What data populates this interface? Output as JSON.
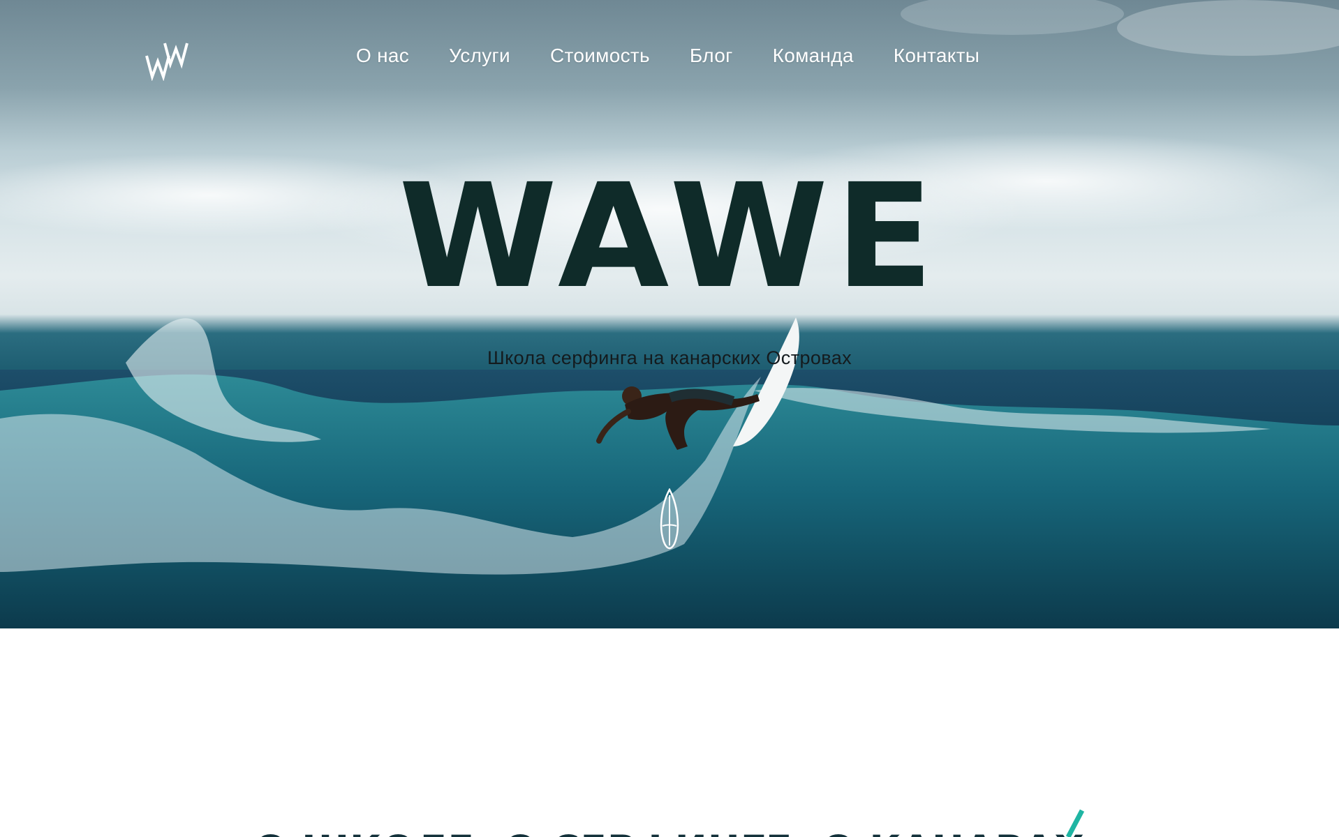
{
  "nav": {
    "logo_icon": "wawe-logo-icon",
    "items": [
      {
        "label": "О нас"
      },
      {
        "label": "Услуги"
      },
      {
        "label": "Стоимость"
      },
      {
        "label": "Блог"
      },
      {
        "label": "Команда"
      },
      {
        "label": "Контакты"
      }
    ]
  },
  "hero": {
    "title": "WAWE",
    "subtitle": "Школа серфинга на канарских Островах",
    "scroll_icon": "surfboard-icon"
  },
  "about": {
    "title": "О ШКОЛЕ, О СЕРФИНГЕ, О КАНАРАХ",
    "accent_icon": "accent-slash-icon"
  },
  "colors": {
    "accent": "#1fb5a3",
    "title_dark": "#0f2b29",
    "section_title": "#13313a"
  }
}
